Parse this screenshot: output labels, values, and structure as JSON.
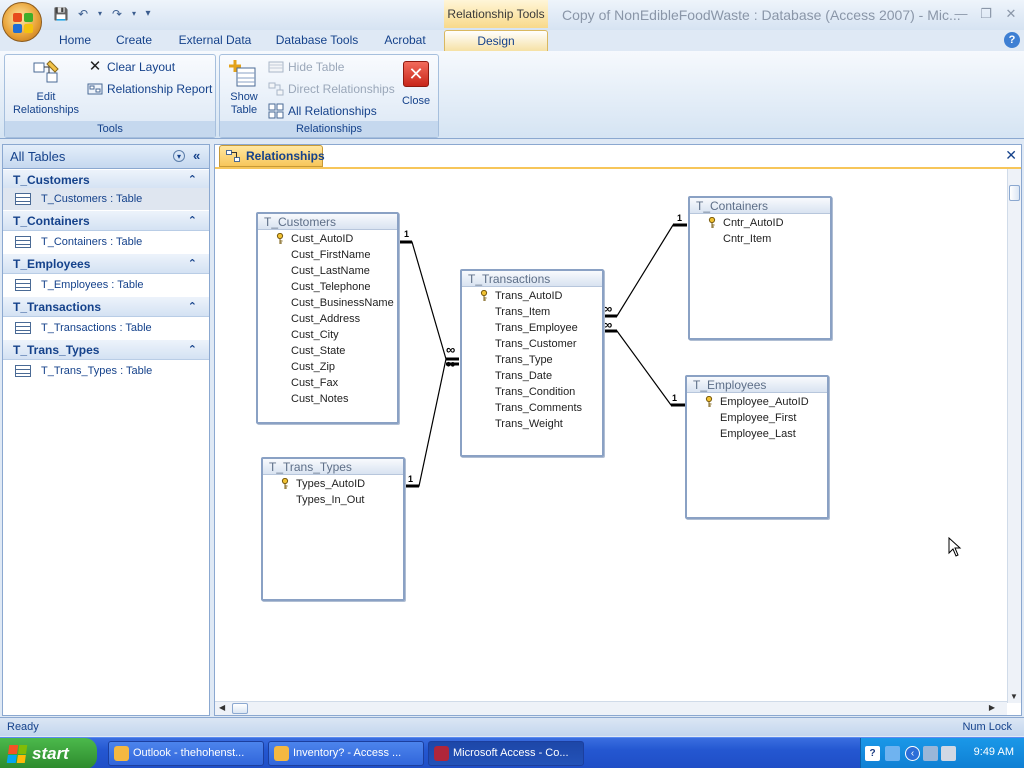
{
  "window": {
    "title": "Copy of NonEdibleFoodWaste : Database (Access 2007) - Mic...",
    "context_tab_group": "Relationship Tools"
  },
  "ribbon": {
    "tabs": [
      "Home",
      "Create",
      "External Data",
      "Database Tools",
      "Acrobat"
    ],
    "active_tab": "Design",
    "groups": {
      "tools": {
        "label": "Tools",
        "edit_relationships": "Edit Relationships",
        "clear_layout": "Clear Layout",
        "relationship_report": "Relationship Report"
      },
      "relationships": {
        "label": "Relationships",
        "show_table": "Show Table",
        "hide_table": "Hide Table",
        "direct_relationships": "Direct Relationships",
        "all_relationships": "All Relationships",
        "close": "Close"
      }
    }
  },
  "nav_pane": {
    "title": "All Tables",
    "groups": [
      {
        "header": "T_Customers",
        "item": "T_Customers : Table"
      },
      {
        "header": "T_Containers",
        "item": "T_Containers : Table"
      },
      {
        "header": "T_Employees",
        "item": "T_Employees : Table"
      },
      {
        "header": "T_Transactions",
        "item": "T_Transactions : Table"
      },
      {
        "header": "T_Trans_Types",
        "item": "T_Trans_Types : Table"
      }
    ]
  },
  "document": {
    "tab_label": "Relationships",
    "tables": {
      "customers": {
        "name": "T_Customers",
        "fields": [
          "Cust_AutoID",
          "Cust_FirstName",
          "Cust_LastName",
          "Cust_Telephone",
          "Cust_BusinessName",
          "Cust_Address",
          "Cust_City",
          "Cust_State",
          "Cust_Zip",
          "Cust_Fax",
          "Cust_Notes"
        ]
      },
      "transactions": {
        "name": "T_Transactions",
        "fields": [
          "Trans_AutoID",
          "Trans_Item",
          "Trans_Employee",
          "Trans_Customer",
          "Trans_Type",
          "Trans_Date",
          "Trans_Condition",
          "Trans_Comments",
          "Trans_Weight"
        ]
      },
      "containers": {
        "name": "T_Containers",
        "fields": [
          "Cntr_AutoID",
          "Cntr_Item"
        ]
      },
      "employees": {
        "name": "T_Employees",
        "fields": [
          "Employee_AutoID",
          "Employee_First",
          "Employee_Last"
        ]
      },
      "trans_types": {
        "name": "T_Trans_Types",
        "fields": [
          "Types_AutoID",
          "Types_In_Out"
        ]
      }
    },
    "relationship_labels": {
      "one": "1",
      "many": "∞"
    }
  },
  "status_bar": {
    "left": "Ready",
    "right": "Num Lock"
  },
  "taskbar": {
    "start": "start",
    "tasks": [
      "Outlook - thehohenst...",
      "Inventory? - Access ...",
      "Microsoft Access - Co..."
    ],
    "clock": "9:49 AM"
  }
}
